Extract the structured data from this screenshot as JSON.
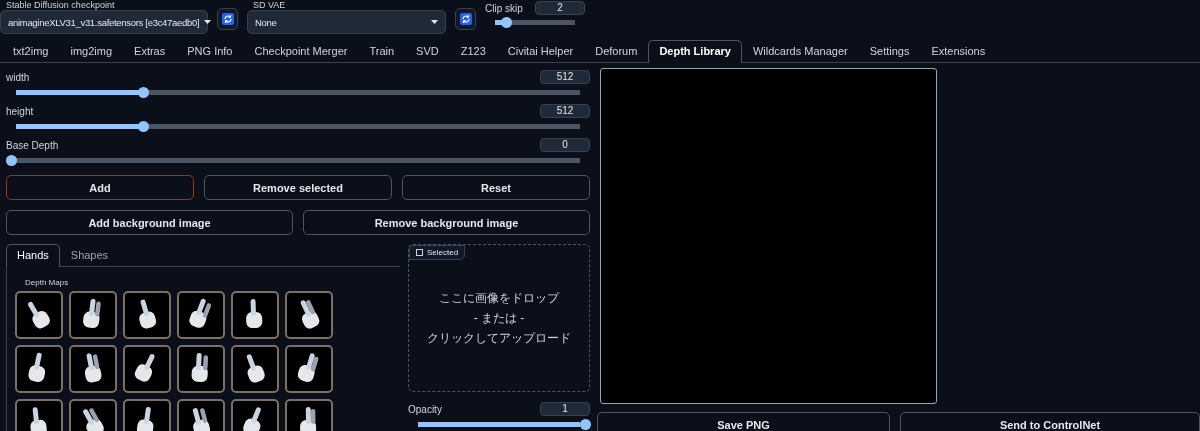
{
  "top_bar": {
    "checkpoint": {
      "label": "Stable Diffusion checkpoint",
      "value": "animagineXLV31_v31.safetensors [e3c47aedb0]"
    },
    "vae": {
      "label": "SD VAE",
      "value": "None"
    },
    "clip_skip": {
      "label": "Clip skip",
      "value": "2",
      "level": 0.18
    }
  },
  "tabs": [
    {
      "label": "txt2img",
      "selected": false
    },
    {
      "label": "img2img",
      "selected": false
    },
    {
      "label": "Extras",
      "selected": false
    },
    {
      "label": "PNG Info",
      "selected": false
    },
    {
      "label": "Checkpoint Merger",
      "selected": false
    },
    {
      "label": "Train",
      "selected": false
    },
    {
      "label": "SVD",
      "selected": false
    },
    {
      "label": "Z123",
      "selected": false
    },
    {
      "label": "Civitai Helper",
      "selected": false
    },
    {
      "label": "Deforum",
      "selected": false
    },
    {
      "label": "Depth Library",
      "selected": true
    },
    {
      "label": "Wildcards Manager",
      "selected": false
    },
    {
      "label": "Settings",
      "selected": false
    },
    {
      "label": "Extensions",
      "selected": false
    }
  ],
  "sliders": [
    {
      "label": "width",
      "value": "512",
      "level": 0.23
    },
    {
      "label": "height",
      "value": "512",
      "level": 0.23
    },
    {
      "label": "Base Depth",
      "value": "0",
      "level": 0
    }
  ],
  "buttons": [
    {
      "label": "Add",
      "kind": "primary"
    },
    {
      "label": "Remove selected",
      "kind": "secondary"
    },
    {
      "label": "Reset",
      "kind": "secondary"
    }
  ],
  "background_buttons": [
    {
      "label": "Add background image",
      "kind": "secondary"
    },
    {
      "label": "Remove background image",
      "kind": "secondary"
    }
  ],
  "library": {
    "tabs": [
      {
        "label": "Hands",
        "selected": true
      },
      {
        "label": "Shapes",
        "selected": false
      }
    ],
    "gallery_label": "Depth Maps",
    "thumbnails": [
      {
        "selected": false
      },
      {
        "selected": false
      },
      {
        "selected": false
      },
      {
        "selected": false
      },
      {
        "selected": false
      },
      {
        "selected": false
      },
      {
        "selected": false
      },
      {
        "selected": false
      },
      {
        "selected": false
      },
      {
        "selected": false
      },
      {
        "selected": false
      },
      {
        "selected": false
      },
      {
        "selected": false
      },
      {
        "selected": false
      },
      {
        "selected": false
      },
      {
        "selected": false
      },
      {
        "selected": false
      },
      {
        "selected": false
      }
    ]
  },
  "upload": {
    "label": "Selected",
    "lines": [
      "ここに画像をドロップ",
      "- または -",
      "クリックしてアップロード"
    ]
  },
  "opacity": {
    "label": "Opacity",
    "value": "1",
    "level": 1
  },
  "canvas_buttons": [
    "Save PNG",
    "Send to ControlNet"
  ]
}
